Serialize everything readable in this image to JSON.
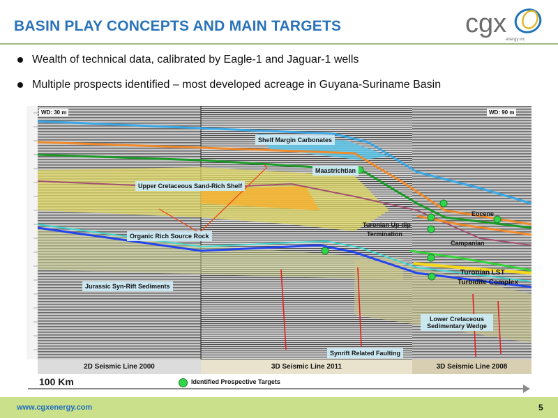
{
  "header": {
    "title": "BASIN PLAY CONCEPTS AND MAIN TARGETS",
    "logo": {
      "text": "cgx",
      "subtext": "energy inc"
    }
  },
  "bullets": [
    "Wealth of technical data, calibrated by Eagle-1 and Jaguar-1 wells",
    "Multiple prospects identified – most developed acreage in Guyana-Suriname Basin"
  ],
  "section": {
    "water_depth_left": "WD: 30 m",
    "water_depth_right": "WD: 90 m",
    "labels": {
      "shelf_margin_carbonates": "Shelf Margin Carbonates",
      "maastrichtian": "Maastrichtian",
      "upper_cretaceous": "Upper Cretaceous Sand-Rich Shelf",
      "organic_rich": "Organic Rich Source Rock",
      "turonian_up": "Turonian Up-dip",
      "termination": "Termination",
      "eocene": "Eocene",
      "campanian": "Campanian",
      "jurassic": "Jurassic Syn-Rift Sediments",
      "turonian_lst": "Turonian LST",
      "turbidite": "Turbidite Complex",
      "lower_cretaceous": "Lower Cretaceous",
      "sedimentary_wedge": "Sedimentary Wedge",
      "synrift": "Synrift Related Faulting"
    },
    "tracks": [
      "2D Seismic Line 2000",
      "3D Seismic Line 2011",
      "3D Seismic Line 2008"
    ],
    "scale": "100 Km",
    "legend": "Identified Prospective Targets"
  },
  "footer": {
    "url": "www.cgxenergy.com",
    "page": "5"
  },
  "colors": {
    "title": "#2a73b8",
    "footer": "#cbe08a",
    "target": "#2fd64a"
  }
}
